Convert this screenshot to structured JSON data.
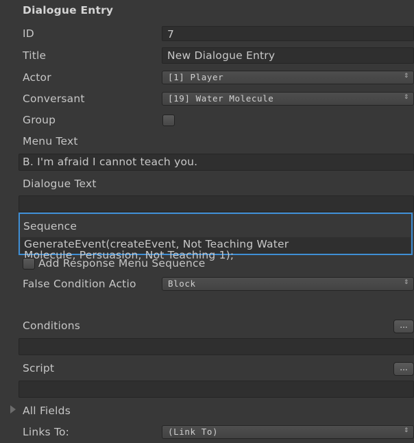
{
  "header": {
    "title": "Dialogue Entry"
  },
  "fields": {
    "id": {
      "label": "ID",
      "value": "7"
    },
    "title": {
      "label": "Title",
      "value": "New Dialogue Entry"
    },
    "actor": {
      "label": "Actor",
      "value": "[1] Player"
    },
    "conversant": {
      "label": "Conversant",
      "value": "[19] Water Molecule"
    },
    "group": {
      "label": "Group",
      "checked": false
    },
    "menu_text": {
      "label": "Menu Text",
      "value": "B. I'm afraid I cannot teach you."
    },
    "dialogue_text": {
      "label": "Dialogue Text",
      "value": ""
    },
    "sequence": {
      "label": "Sequence",
      "line1": "GenerateEvent(createEvent, Not Teaching Water",
      "line2": "Molecule, Persuasion, Not Teaching 1);"
    },
    "add_response_menu_sequence": {
      "label": "Add Response Menu Sequence",
      "checked": false
    },
    "false_condition_action": {
      "label": "False Condition Actio",
      "value": "Block"
    },
    "conditions": {
      "label": "Conditions",
      "button": "...",
      "value": ""
    },
    "script": {
      "label": "Script",
      "button": "...",
      "value": ""
    },
    "all_fields": {
      "label": "All Fields"
    },
    "links_to": {
      "label": "Links To:",
      "value": "(Link To)"
    }
  },
  "icons": {
    "dropdown_arrow": "⇕",
    "foldout": "triangle-right-icon"
  },
  "colors": {
    "background": "#383838",
    "field": "#2f2f2f",
    "highlight": "#3f8fd6"
  }
}
